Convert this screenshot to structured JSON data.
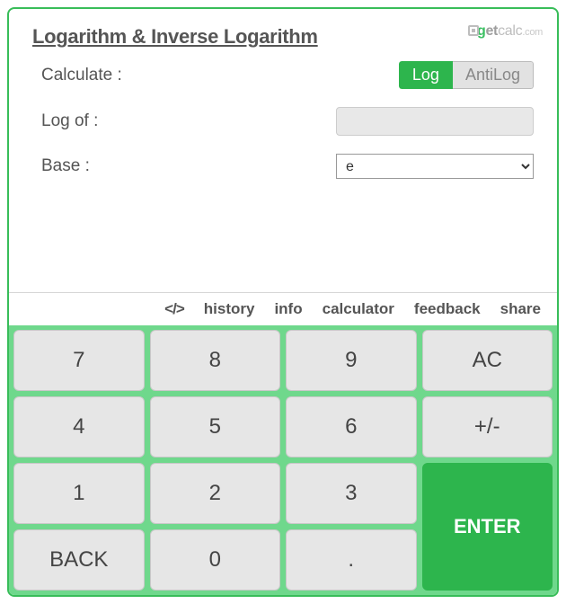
{
  "brand": {
    "text_g": "g",
    "text_et": "et",
    "text_calc": "calc",
    "text_com": ".com"
  },
  "title": "Logarithm & Inverse Logarithm",
  "rows": {
    "calculate_label": "Calculate :",
    "logof_label": "Log of :",
    "base_label": "Base :"
  },
  "toggle": {
    "log": "Log",
    "antilog": "AntiLog"
  },
  "inputs": {
    "logof_value": "",
    "base_value": "e"
  },
  "tabs": {
    "code": "</>",
    "history": "history",
    "info": "info",
    "calculator": "calculator",
    "feedback": "feedback",
    "share": "share"
  },
  "keys": {
    "k7": "7",
    "k8": "8",
    "k9": "9",
    "ac": "AC",
    "k4": "4",
    "k5": "5",
    "k6": "6",
    "pm": "+/-",
    "k1": "1",
    "k2": "2",
    "k3": "3",
    "enter": "ENTER",
    "back": "BACK",
    "k0": "0",
    "dot": "."
  }
}
